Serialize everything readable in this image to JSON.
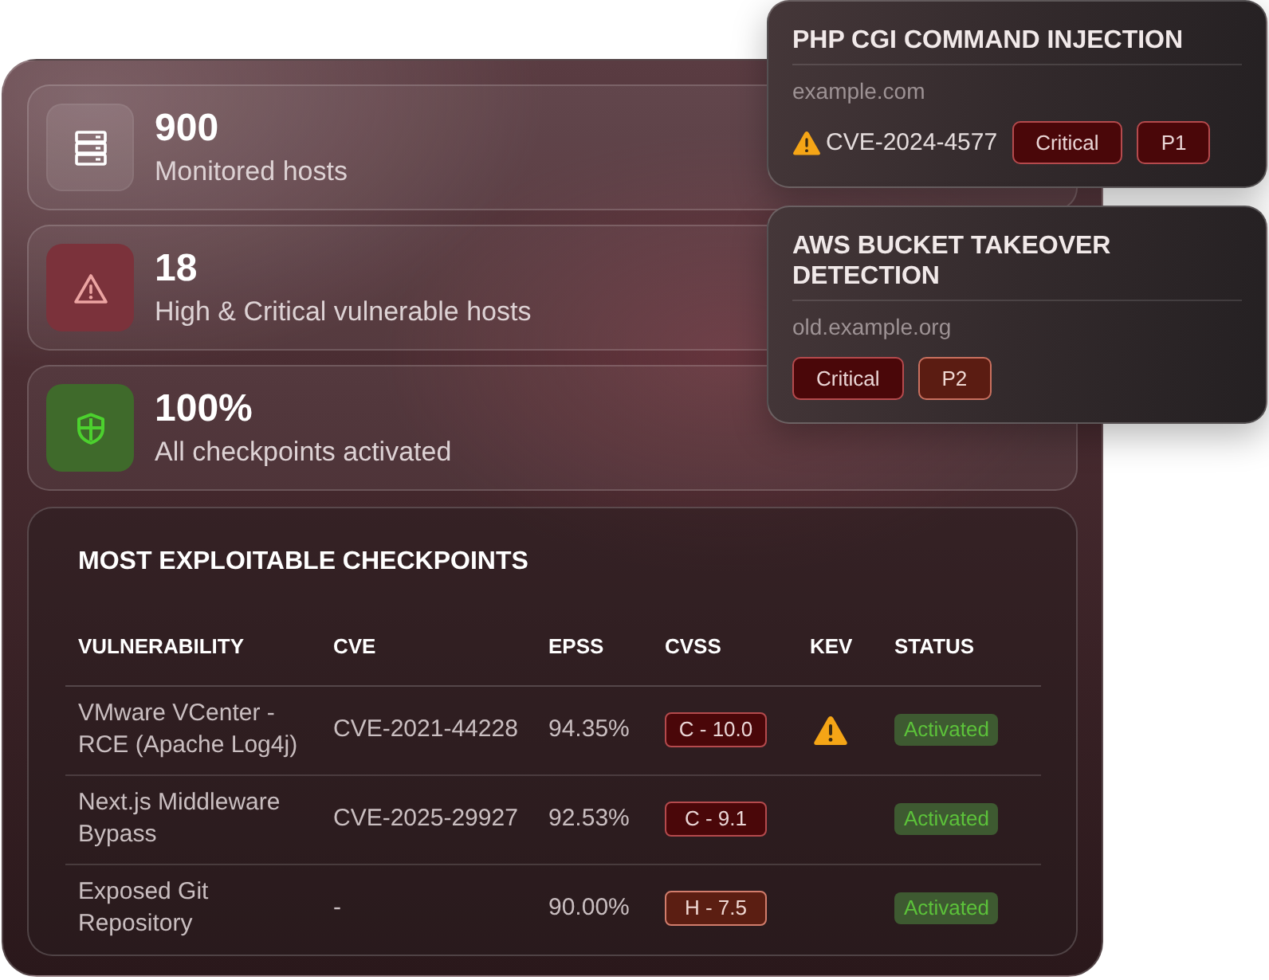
{
  "stats": [
    {
      "kind": "neutral",
      "value": "900",
      "label": "Monitored hosts"
    },
    {
      "kind": "danger",
      "value": "18",
      "label": "High & Critical vulnerable hosts"
    },
    {
      "kind": "success",
      "value": "100%",
      "label": "All checkpoints activated"
    }
  ],
  "checkpoints": {
    "title": "MOST EXPLOITABLE CHECKPOINTS",
    "columns": [
      "VULNERABILITY",
      "CVE",
      "EPSS",
      "CVSS",
      "KEV",
      "STATUS"
    ],
    "rows": [
      {
        "vulnerability": "VMware VCenter - RCE (Apache Log4j)",
        "cve": "CVE-2021-44228",
        "epss": "94.35%",
        "cvss": {
          "text": "C - 10.0",
          "kind": "critical"
        },
        "kev": true,
        "status": "Activated"
      },
      {
        "vulnerability": "Next.js Middleware Bypass",
        "cve": "CVE-2025-29927",
        "epss": "92.53%",
        "cvss": {
          "text": "C - 9.1",
          "kind": "critical"
        },
        "kev": false,
        "status": "Activated"
      },
      {
        "vulnerability": "Exposed Git Repository",
        "cve": "-",
        "epss": "90.00%",
        "cvss": {
          "text": "H - 7.5",
          "kind": "high"
        },
        "kev": false,
        "status": "Activated"
      }
    ]
  },
  "alerts": [
    {
      "title": "PHP CGI COMMAND INJECTION",
      "host": "example.com",
      "kev": true,
      "cve": "CVE-2024-4577",
      "severity": {
        "text": "Critical",
        "kind": "critical"
      },
      "priority": {
        "text": "P1",
        "kind": "critical"
      }
    },
    {
      "title": "AWS BUCKET TAKEOVER DETECTION",
      "host": "old.example.org",
      "kev": false,
      "severity": {
        "text": "Critical",
        "kind": "critical"
      },
      "priority": {
        "text": "P2",
        "kind": "high"
      }
    }
  ]
}
